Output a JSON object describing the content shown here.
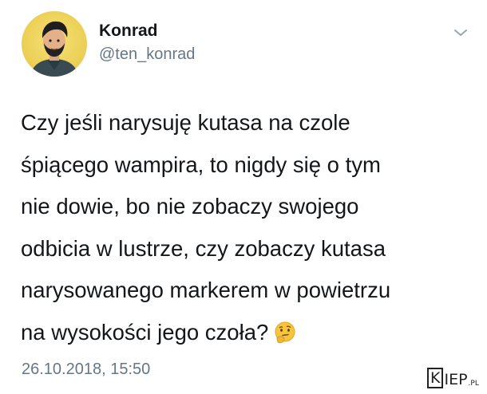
{
  "user": {
    "display_name": "Konrad",
    "username": "@ten_konrad"
  },
  "tweet": {
    "lines": [
      "Czy jeśli narysuję kutasa na czole",
      "śpiącego wampira, to nigdy się o tym",
      "nie dowie, bo nie zobaczy swojego",
      "odbicia w lustrze, czy zobaczy kutasa",
      "narysowanego markerem w powietrzu",
      "na wysokości jego czoła?"
    ],
    "emoji": "thinking-face",
    "timestamp": "26.10.2018, 15:50"
  },
  "menu": {
    "icon": "chevron-down-icon"
  },
  "watermark": {
    "k": "K",
    "rest": "IEP",
    "suffix": ".PL"
  },
  "colors": {
    "text": "#14171a",
    "secondary": "#657786",
    "avatar_bg": "#edd25a"
  }
}
